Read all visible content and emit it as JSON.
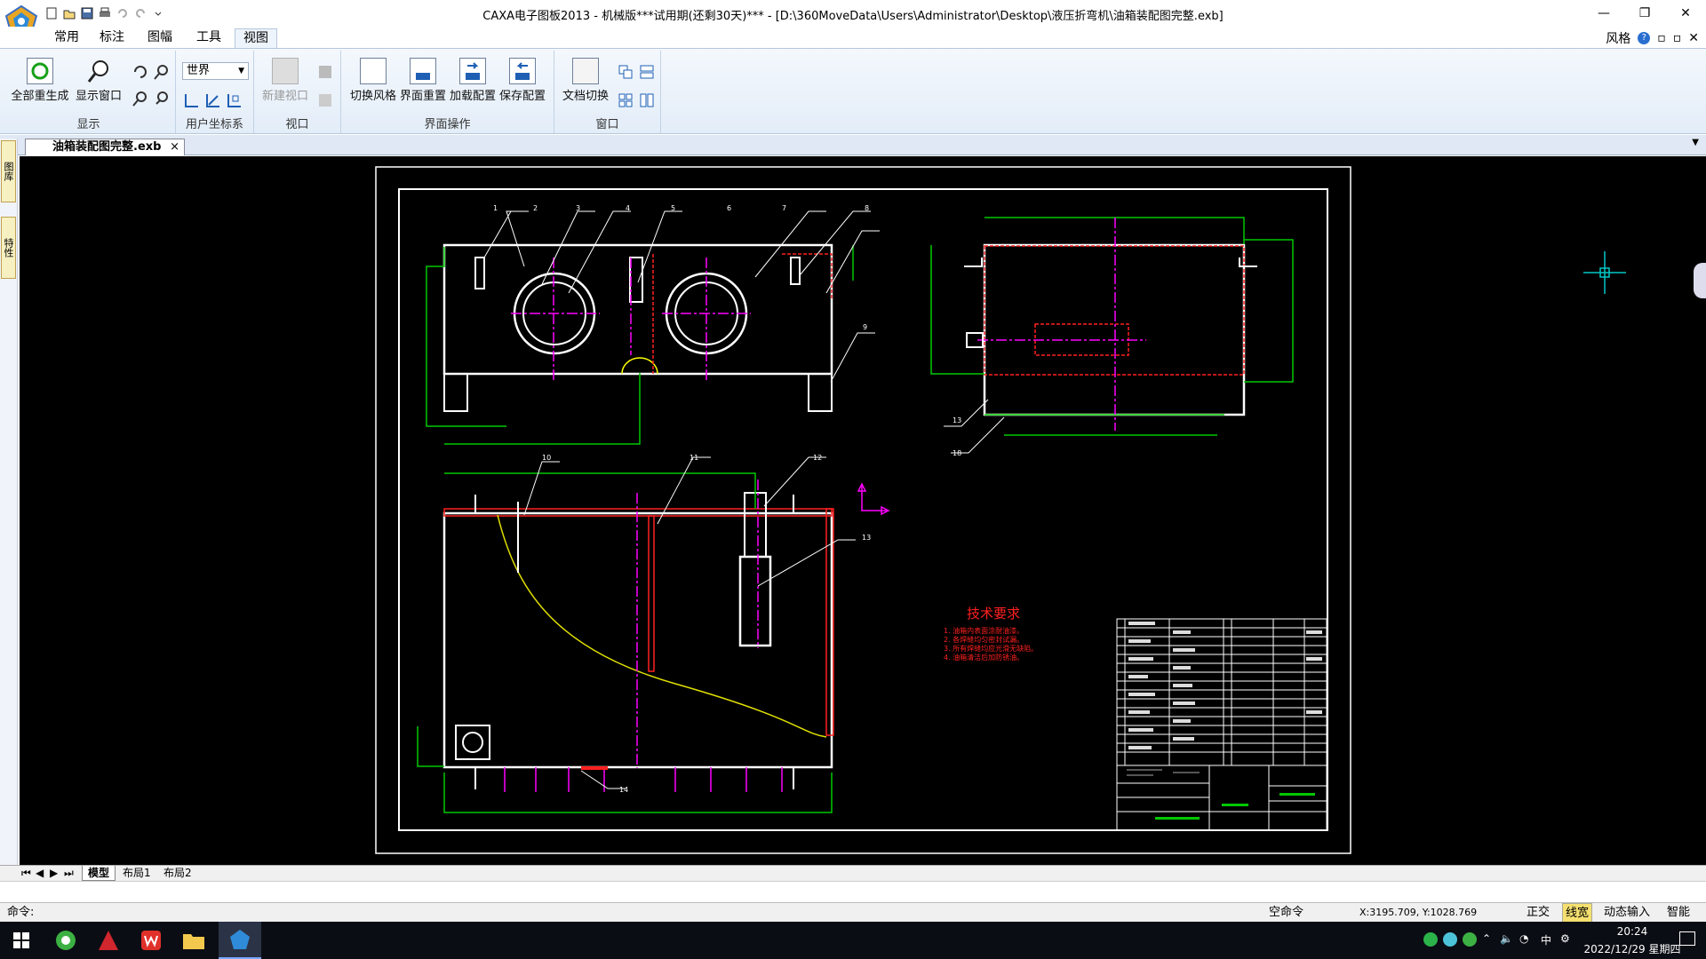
{
  "window": {
    "title": "CAXA电子图板2013 - 机械版***试用期(还剩30天)*** - [D:\\360MoveData\\Users\\Administrator\\Desktop\\液压折弯机\\油箱装配图完整.exb]",
    "style_label": "风格",
    "min": "—",
    "max": "❐",
    "close": "✕"
  },
  "ribbon": {
    "tabs": [
      "常用",
      "标注",
      "图幅",
      "工具",
      "视图"
    ],
    "active_tab": "视图",
    "groups": {
      "display": {
        "label": "显示",
        "regen": "全部重生成",
        "show_window": "显示窗口"
      },
      "ucs": {
        "label": "用户坐标系",
        "select_value": "世界"
      },
      "viewport": {
        "label": "视口",
        "new_viewport": "新建视口"
      },
      "ui_ops": {
        "label": "界面操作",
        "switch_style": "切换风格",
        "reset_ui": "界面重置",
        "load_config": "加载配置",
        "save_config": "保存配置"
      },
      "window": {
        "label": "窗口",
        "doc_switch": "文档切换"
      }
    }
  },
  "document": {
    "tab_name": "油箱装配图完整.exb",
    "close": "×"
  },
  "left_strip": {
    "btn1": "图库",
    "btn2": "特性"
  },
  "drawing": {
    "tech_title": "技术要求",
    "tech_notes": [
      "1. 油箱内表面涂耐油漆。",
      "2. 各焊缝均匀密封试漏。",
      "3. 所有焊缝均应光滑无缺陷。",
      "4. 油箱清洁后加防锈油。"
    ],
    "callouts": [
      "1",
      "2",
      "3",
      "4",
      "5",
      "6",
      "7",
      "8",
      "9",
      "10",
      "11",
      "12",
      "13",
      "13",
      "18",
      "14"
    ]
  },
  "layout_tabs": [
    "模型",
    "布局1",
    "布局2"
  ],
  "status": {
    "command_label": "命令:",
    "mode": "空命令",
    "coords": "X:3195.709, Y:1028.769",
    "ortho": "正交",
    "linewidth": "线宽",
    "dynamic_input": "动态输入",
    "smart": "智能"
  },
  "taskbar": {
    "time": "20:24",
    "date": "2022/12/29 星期四",
    "ime": "中"
  },
  "colors": {
    "accent": "#1e5fb4",
    "canvas": "#000000",
    "drawing_green": "#00c800",
    "drawing_red": "#ff2020",
    "drawing_magenta": "#ff00ff"
  }
}
